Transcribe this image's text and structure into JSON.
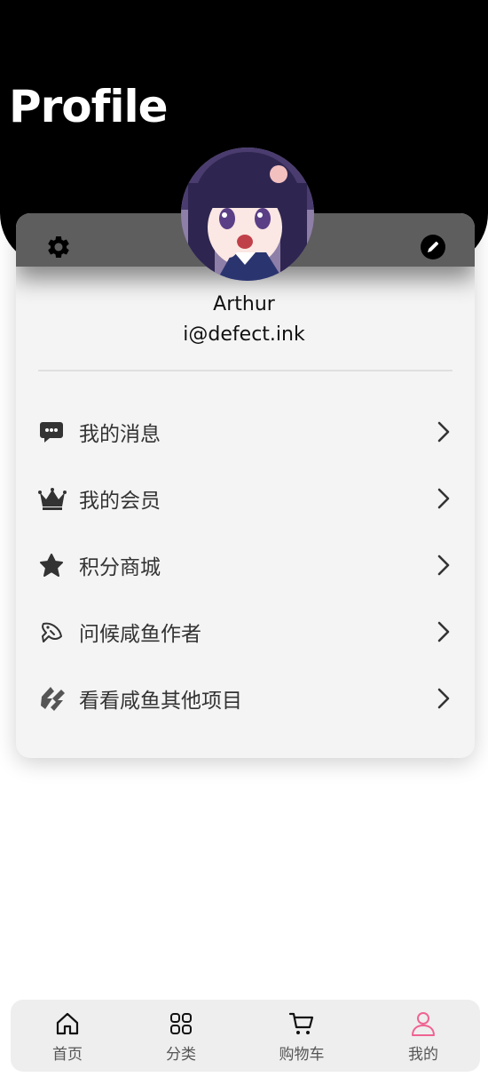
{
  "header": {
    "title": "Profile"
  },
  "profile": {
    "name": "Arthur",
    "email": "i@defect.ink",
    "avatar_icon": "anime-girl-avatar"
  },
  "card_actions": {
    "settings_icon": "gear-icon",
    "edit_icon": "pencil-icon"
  },
  "menu": [
    {
      "label": "我的消息",
      "icon": "message-icon"
    },
    {
      "label": "我的会员",
      "icon": "crown-icon"
    },
    {
      "label": "积分商城",
      "icon": "star-icon"
    },
    {
      "label": "问候咸鱼作者",
      "icon": "fish-icon"
    },
    {
      "label": "看看咸鱼其他项目",
      "icon": "logo-icon"
    }
  ],
  "tabs": [
    {
      "label": "首页",
      "icon": "home-icon",
      "active": false
    },
    {
      "label": "分类",
      "icon": "grid-icon",
      "active": false
    },
    {
      "label": "购物车",
      "icon": "cart-icon",
      "active": false
    },
    {
      "label": "我的",
      "icon": "user-icon",
      "active": true
    }
  ],
  "colors": {
    "accent": "#f06292",
    "header_bg": "#000000",
    "card_bg": "#f4f4f4"
  }
}
